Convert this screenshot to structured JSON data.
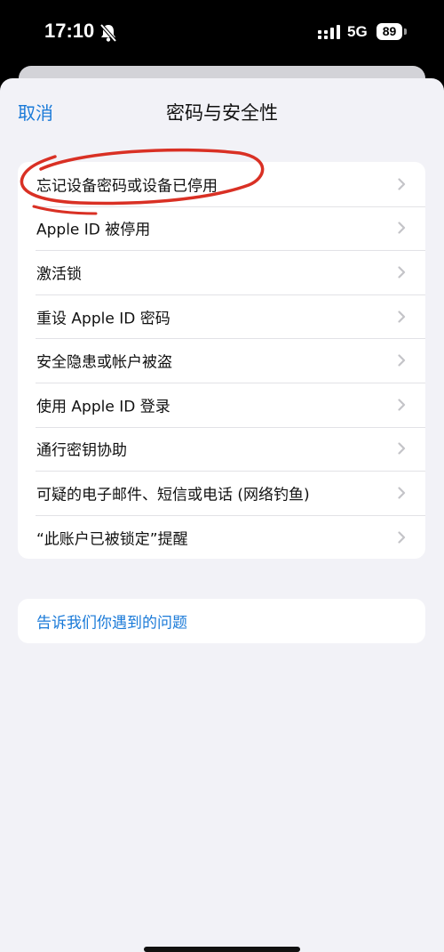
{
  "status_bar": {
    "time": "17:10",
    "network": "5G",
    "battery": "89"
  },
  "nav": {
    "cancel": "取消",
    "title": "密码与安全性"
  },
  "menu": {
    "items": [
      {
        "label": "忘记设备密码或设备已停用"
      },
      {
        "label": "Apple ID 被停用"
      },
      {
        "label": "激活锁"
      },
      {
        "label": "重设 Apple ID 密码"
      },
      {
        "label": "安全隐患或帐户被盗"
      },
      {
        "label": "使用 Apple ID 登录"
      },
      {
        "label": "通行密钥协助"
      },
      {
        "label": "可疑的电子邮件、短信或电话 (网络钓鱼)"
      },
      {
        "label": "“此账户已被锁定”提醒"
      }
    ]
  },
  "report": {
    "label": "告诉我们你遇到的问题"
  },
  "colors": {
    "accent": "#1a7ad8",
    "annotation": "#d93024",
    "background": "#f2f2f7"
  },
  "icons": {
    "chevron": "chevron-right-icon",
    "muted": "bell-slash-icon",
    "signal": "cellular-signal-icon"
  }
}
